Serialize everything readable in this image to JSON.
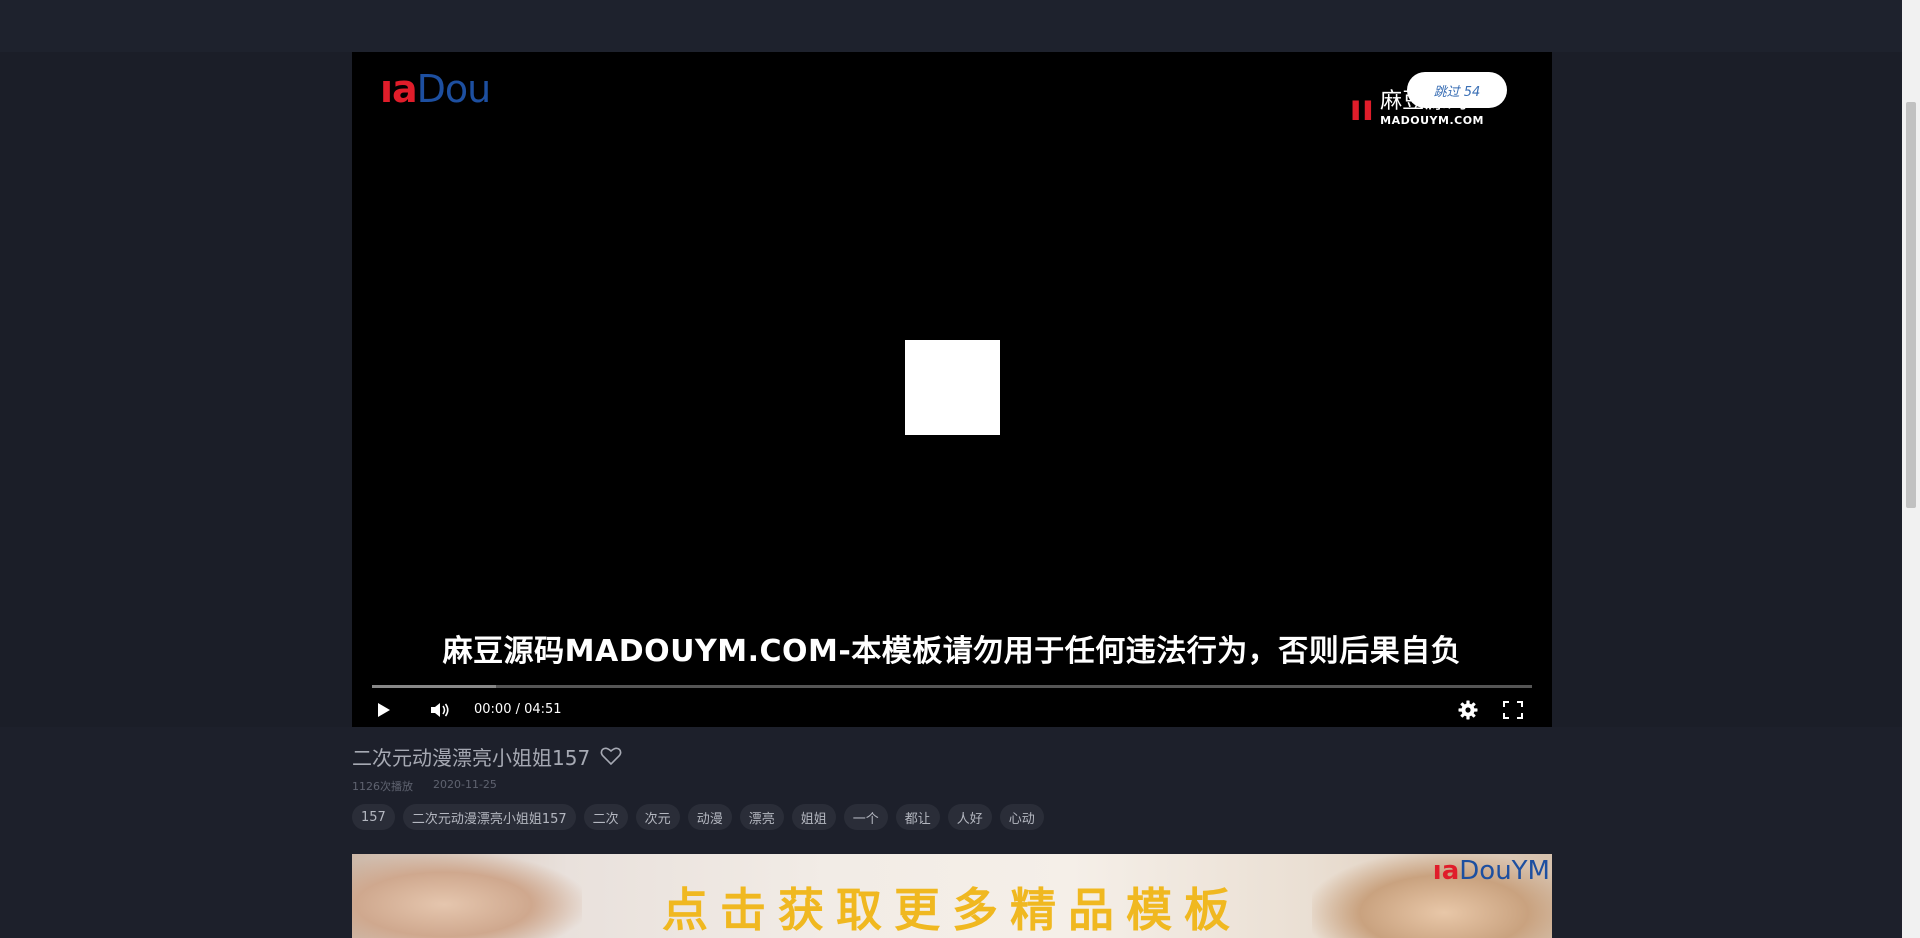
{
  "player": {
    "logo_left": {
      "m": "ı",
      "a": "ıa",
      "rest": "Dou"
    },
    "logo_right": {
      "mark": "ıı",
      "cn": "麻豆源码",
      "en": "MADOUYM.COM"
    },
    "skip_label": "跳过 54",
    "caption": "麻豆源码MADOUYM.COM-本模板请勿用于任何违法行为，否则后果自负",
    "time": "00:00 / 04:51",
    "buffered_fraction": 0.107,
    "icons": {
      "play": "play-icon",
      "volume": "volume-icon",
      "settings": "gear-icon",
      "fullscreen": "fullscreen-icon"
    }
  },
  "video": {
    "title": "二次元动漫漂亮小姐姐157",
    "plays": "1126次播放",
    "date": "2020-11-25",
    "tags": [
      "157",
      "二次元动漫漂亮小姐姐157",
      "二次",
      "次元",
      "动漫",
      "漂亮",
      "姐姐",
      "一个",
      "都让",
      "人好",
      "心动"
    ]
  },
  "banner": {
    "promo": "点击获取更多精品模板",
    "logo": {
      "m": "ıa",
      "rest": "DouYM"
    }
  },
  "colors": {
    "background": "#1d202b",
    "promo_text": "#f0b820",
    "brand_red": "#e01d2a",
    "brand_blue": "#1d4fa0"
  }
}
